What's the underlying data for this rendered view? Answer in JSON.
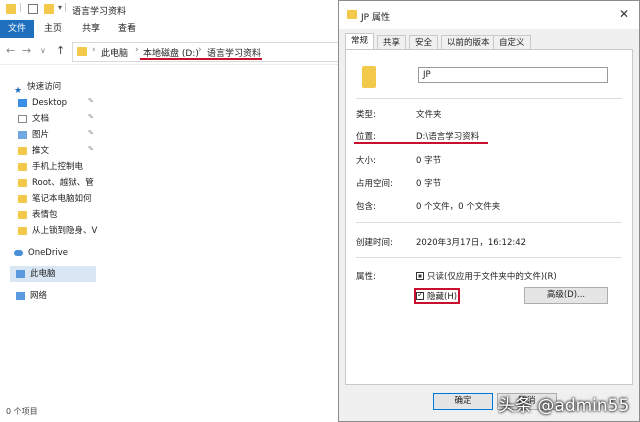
{
  "explorer": {
    "title": "语言学习资料",
    "ribbon_tabs": [
      "文件",
      "主页",
      "共享",
      "查看"
    ],
    "breadcrumbs": [
      "此电脑",
      "本地磁盘 (D:)",
      "语言学习资料"
    ],
    "sidebar": {
      "quick_access": "快速访问",
      "items": [
        "Desktop",
        "文档",
        "图片",
        "推文",
        "手机上控制电",
        "Root、越狱、管",
        "笔记本电脑如何",
        "表情包",
        "从上锁到隐身、V"
      ],
      "onedrive": "OneDrive",
      "thispc": "此电脑",
      "network": "网络"
    },
    "status": "0 个项目"
  },
  "dialog": {
    "title": "JP 属性",
    "tabs": [
      "常规",
      "共享",
      "安全",
      "以前的版本",
      "自定义"
    ],
    "name_value": "JP",
    "rows": {
      "type_label": "类型:",
      "type_value": "文件夹",
      "location_label": "位置:",
      "location_value": "D:\\语言学习资料",
      "size_label": "大小:",
      "size_value": "0 字节",
      "disk_size_label": "占用空间:",
      "disk_size_value": "0 字节",
      "contains_label": "包含:",
      "contains_value": "0 个文件，0 个文件夹",
      "created_label": "创建时间:",
      "created_value": "2020年3月17日，16:12:42",
      "attributes_label": "属性:"
    },
    "readonly_label": "只读(仅应用于文件夹中的文件)(R)",
    "hidden_label": "隐藏(H)",
    "advanced_label": "高级(D)...",
    "ok_label": "确定",
    "cancel_label": "取消"
  },
  "watermark": "头条 @admin55",
  "colors": {
    "accent": "#1f6fbf",
    "highlight_red": "#c8102e",
    "folder": "#f3c94b"
  }
}
